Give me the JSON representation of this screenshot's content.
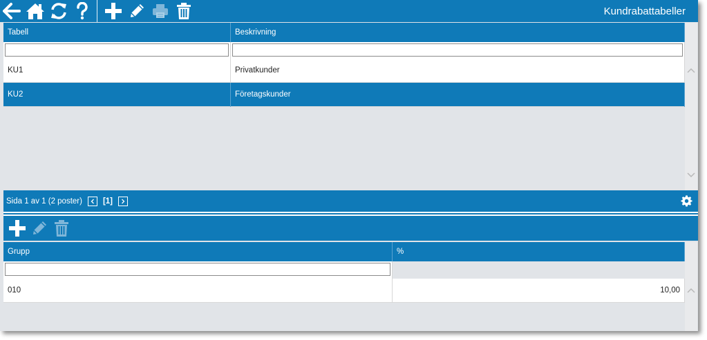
{
  "app": {
    "title": "Kundrabattabeller"
  },
  "toolbar": {
    "buttons": [
      {
        "icon": "back-arrow-icon",
        "enabled": true
      },
      {
        "icon": "home-icon",
        "enabled": true
      },
      {
        "icon": "refresh-icon",
        "enabled": true
      },
      {
        "icon": "help-icon",
        "enabled": true
      },
      {
        "icon": "add-icon",
        "enabled": true
      },
      {
        "icon": "edit-icon",
        "enabled": true
      },
      {
        "icon": "print-icon",
        "enabled": false
      },
      {
        "icon": "delete-icon",
        "enabled": true
      }
    ]
  },
  "upper_grid": {
    "columns": [
      "Tabell",
      "Beskrivning"
    ],
    "filter_values": [
      "",
      ""
    ],
    "rows": [
      {
        "tabell": "KU1",
        "beskrivning": "Privatkunder",
        "selected": false
      },
      {
        "tabell": "KU2",
        "beskrivning": "Företagskunder",
        "selected": true
      }
    ]
  },
  "pager": {
    "info": "Sida 1 av 1 (2 poster)",
    "current_page": "[1]"
  },
  "lower_toolbar": {
    "buttons": [
      {
        "icon": "add-icon",
        "enabled": true
      },
      {
        "icon": "edit-icon",
        "enabled": false
      },
      {
        "icon": "delete-icon",
        "enabled": false
      }
    ]
  },
  "lower_grid": {
    "columns": [
      "Grupp",
      "%"
    ],
    "filter_values": [
      ""
    ],
    "rows": [
      {
        "grupp": "010",
        "procent": "10,00"
      }
    ]
  },
  "colors": {
    "accent": "#0f7ab8",
    "background": "#e1e4e8",
    "disabled_icon": "#7fb6d9"
  }
}
